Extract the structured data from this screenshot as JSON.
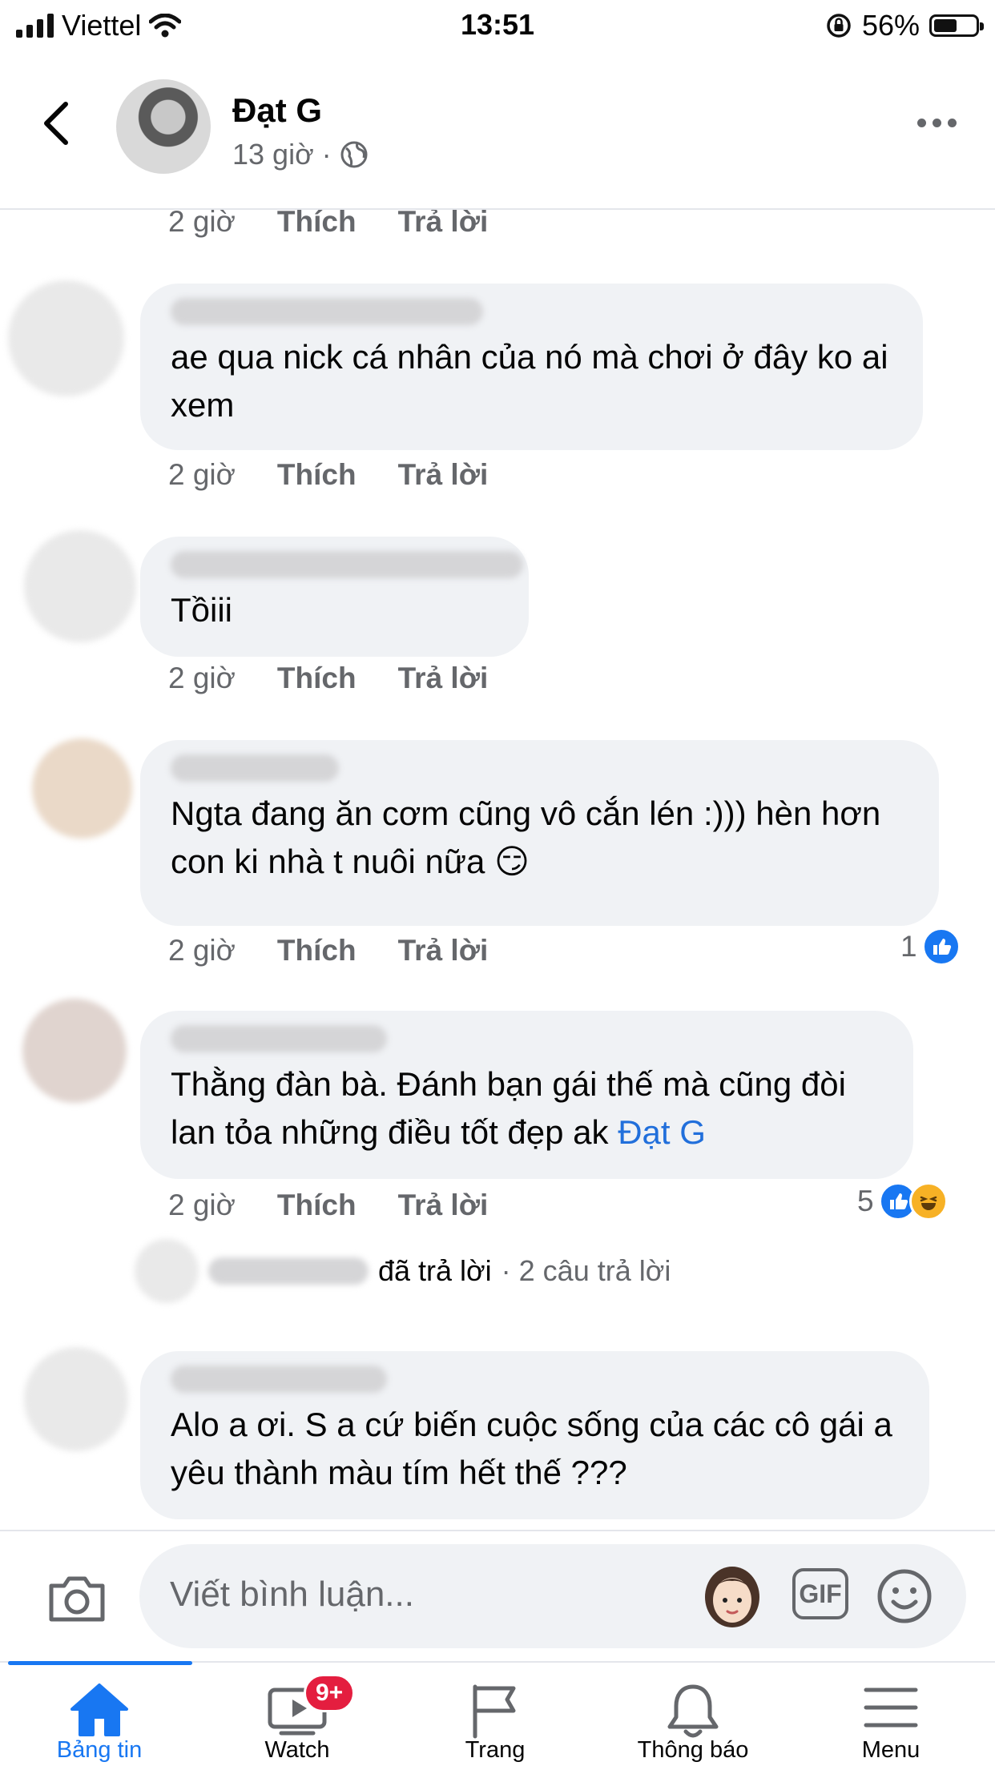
{
  "status_bar": {
    "carrier": "Viettel",
    "time": "13:51",
    "battery": "56%",
    "battery_level": 0.56
  },
  "header": {
    "page_name": "Đạt G",
    "post_time": "13 giờ",
    "separator": "·"
  },
  "actions": {
    "like": "Thích",
    "reply": "Trả lời"
  },
  "comments": [
    {
      "text": "",
      "time": "2 giờ",
      "reaction_count": ""
    },
    {
      "text": "ae qua nick cá nhân của nó mà chơi ở đây ko ai xem",
      "time": "2 giờ",
      "reaction_count": ""
    },
    {
      "text": "Tồiii",
      "time": "2 giờ",
      "reaction_count": ""
    },
    {
      "text": "Ngta đang ăn cơm cũng vô cắn lén :))) hèn hơn con ki nhà t nuôi nữa",
      "emoji": "😏",
      "time": "2 giờ",
      "reaction_count": "1",
      "reaction_types": [
        "like-icon"
      ]
    },
    {
      "text": "Thằng đàn bà. Đánh bạn gái thế mà cũng đòi lan tỏa những điều tốt đẹp ak ",
      "mention": "Đạt G",
      "time": "2 giờ",
      "reaction_count": "5",
      "reaction_types": [
        "like-icon",
        "haha-icon"
      ]
    },
    {
      "text": "Alo a ơi. S a cứ biến cuộc sống của các cô gái a yêu thành màu tím hết thế ???"
    }
  ],
  "reply_summary": {
    "replied": "đã trả lời",
    "count": "· 2 câu trả lời"
  },
  "composer": {
    "placeholder": "Viết bình luận...",
    "gif_label": "GIF"
  },
  "tabbar": {
    "tabs": [
      {
        "label": "Bảng tin",
        "icon": "home-icon",
        "active": true
      },
      {
        "label": "Watch",
        "icon": "watch-icon",
        "badge": "9+"
      },
      {
        "label": "Trang",
        "icon": "flag-icon"
      },
      {
        "label": "Thông báo",
        "icon": "bell-icon"
      },
      {
        "label": "Menu",
        "icon": "menu-icon"
      }
    ]
  },
  "colors": {
    "brand_blue": "#1877f2",
    "mention_blue": "#216fdb",
    "badge_red": "#e41e3f",
    "bubble_bg": "#f0f2f5",
    "secondary_text": "#65676b"
  }
}
